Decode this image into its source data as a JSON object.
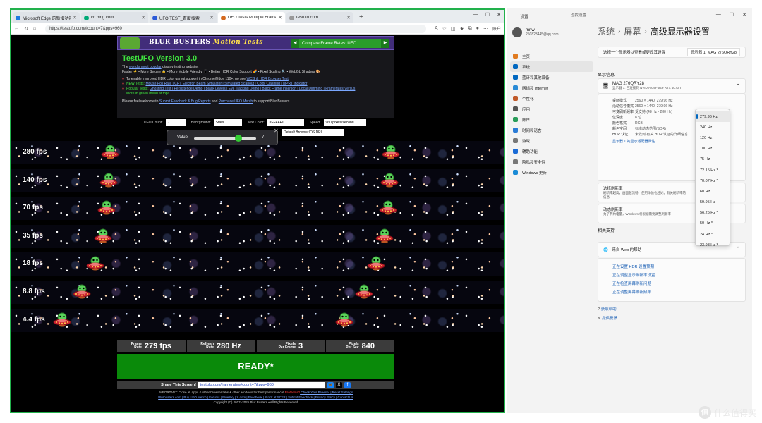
{
  "browser": {
    "tabs": [
      {
        "label": "Microsoft Edge 的新增功能",
        "color": "#1f7ae0"
      },
      {
        "label": "cn.bing.com",
        "color": "#0a7"
      },
      {
        "label": "UFO TEST_百度搜索",
        "color": "#2c5ad8"
      },
      {
        "label": "UFO Tests Multiple Framerates",
        "color": "#d46a1f",
        "active": true
      },
      {
        "label": "testufo.com",
        "color": "#999"
      }
    ],
    "new_tab": "+",
    "url": "https://testufo.com/#count=7&pps=960",
    "account": "账户"
  },
  "header": {
    "brand_a": "BLUR BUSTERS",
    "brand_b": "Motion Tests",
    "compare_select": "Compare Frame Rates: UFO"
  },
  "info": {
    "title": "TestUFO Version 3.0",
    "line1_a": "The ",
    "line1_link": "world's most popular",
    "line1_b": " display testing website.",
    "line2": "Faster ⚡ • More Secure 🔒 • More Mobile Friendly 📱 • Better HDR Color Support 🌈 • Pixel Scaling 🔍 • WebGL Shaders 🎨",
    "b1_a": "To enable improved HDR color gamut support in Chrome/Edge 110+, go see ",
    "b1_link": "WCG & HDR Browser Test",
    "b2_label": "NEW Tests:",
    "b2_links": "Mouse Poll Rate | CRT Electron Beam Simulator | Simulated Scanout | Color Clashing | MPRT Indicator",
    "b3_label": "Popular Tests:",
    "b3_links": "Ghosting Test | Persistence Demo | Black Levels | Eye Tracking Demo | Black Frame Insertion | Local Dimming | Framerates Versus",
    "b3_more": "More in green menu at top!",
    "support_a": "Please feel welcome to ",
    "support_l1": "Submit Feedback & Bug Reports",
    "support_b": " and ",
    "support_l2": "Purchase UFO Merch",
    "support_c": " to support Blur Busters."
  },
  "controls": {
    "ufo_count_label": "UFO Count:",
    "ufo_count": "7",
    "background_label": "Background:",
    "background": "Stars",
    "text_color_label": "Text Color:",
    "text_color": "#FFFFF0",
    "speed_label": "Speed:",
    "speed": "960 pixels/second",
    "value_label": "Value",
    "value": "7",
    "dpi_select": "Default Browser/OS DPI",
    "slider_fraction": 0.72
  },
  "rows": [
    {
      "fps": "280 fps",
      "u1": 0.2,
      "u2": 0.766
    },
    {
      "fps": "140 fps",
      "u1": 0.197,
      "u2": 0.764
    },
    {
      "fps": "70 fps",
      "u1": 0.193,
      "u2": 0.76
    },
    {
      "fps": "35 fps",
      "u1": 0.185,
      "u2": 0.753
    },
    {
      "fps": "18 fps",
      "u1": 0.17,
      "u2": 0.737
    },
    {
      "fps": "8.8 fps",
      "u1": 0.143,
      "u2": 0.712
    },
    {
      "fps": "4.4 fps",
      "u1": 0.103,
      "u2": 0.673
    }
  ],
  "stats": [
    {
      "k1": "Frame",
      "k2": "Rate",
      "v": "279 fps"
    },
    {
      "k1": "Refresh",
      "k2": "Rate",
      "v": "280 Hz"
    },
    {
      "k1": "Pixels",
      "k2": "Per Frame",
      "v": "3"
    },
    {
      "k1": "Pixels",
      "k2": "Per Sec",
      "v": "840"
    }
  ],
  "ready": "READY*",
  "share": {
    "label": "Share This Screen!",
    "url": "testufo.com/framerates#count=7&pps=960"
  },
  "footer": {
    "l1_a": "IMPORTANT: Close all apps & other browser tabs & other windows for best performance! ",
    "l1_red": "Problems?",
    "l1_links": " Check Your Browser | Reset Settings",
    "l2": "Blurbusters.com | Buy UFO Merch | Forums | BlueSky | X.com | Facebook | Stock at SCE2 | Submit Feedback | Privacy Policy | Contact Us",
    "l3": "Copyright (C) 2017–2025 Blur Busters • All Rights Reserved"
  },
  "settings": {
    "title": "设置",
    "search": "查找设置",
    "user_name": "mr.w",
    "user_email": "250823445@qq.com",
    "nav": [
      {
        "label": "主页",
        "color": "#e07a1f"
      },
      {
        "label": "系统",
        "color": "#0067c0",
        "active": true
      },
      {
        "label": "蓝牙和其他设备",
        "color": "#0067c0"
      },
      {
        "label": "网络和 Internet",
        "color": "#2a8bd6"
      },
      {
        "label": "个性化",
        "color": "#c05a2a"
      },
      {
        "label": "应用",
        "color": "#555"
      },
      {
        "label": "账户",
        "color": "#2a9d5a"
      },
      {
        "label": "时间和语言",
        "color": "#2a7bd6"
      },
      {
        "label": "游戏",
        "color": "#777"
      },
      {
        "label": "辅助功能",
        "color": "#1a6bd6"
      },
      {
        "label": "隐私和安全性",
        "color": "#777"
      },
      {
        "label": "Windows 更新",
        "color": "#1a8bd6"
      }
    ],
    "crumb": [
      "系统",
      "屏幕",
      "高级显示器设置"
    ],
    "display_select_label": "选择一个显示器以查看或更改其设置",
    "display_select": "显示器 1: MAG 276QRY28",
    "display_info": "显示信息",
    "monitor_name": "MAG 276QRY28",
    "monitor_sub": "显示器 1: 已连接到 NVIDIA GeForce RTX 4070 Ti",
    "rows": [
      {
        "k": "桌面模式",
        "v": "2560 × 1440, 279.96 Hz"
      },
      {
        "k": "活动信号模式",
        "v": "2560 × 1440, 279.96 Hz"
      },
      {
        "k": "可变刷新频率",
        "v": "受支持 (48 Hz - 280 Hz)"
      },
      {
        "k": "位深度",
        "v": "8 位"
      },
      {
        "k": "颜色格式",
        "v": "RGB"
      },
      {
        "k": "颜色空间",
        "v": "标准动态范围(SDR)"
      },
      {
        "k": "HDR 认证",
        "v": "未找到 有关 HDR 认证的详细信息"
      }
    ],
    "adapter_link": "显示器 1 的显示适配器属性",
    "refresh_title": "选择刷新率",
    "refresh_desc": "刷新率越高，画面越流畅，使用体验也越好。有关刷新率的信息",
    "dyn_title": "动态刷新率",
    "dyn_desc": "为了节约电量，Windows 将根据需要调整刷新率",
    "related": "相关支持",
    "help_title": "来自 Web 的帮助",
    "help_links": [
      "正在设置 HDR 设置预期",
      "正在调整显示刷新率设置",
      "正在检查屏幕刷新问题",
      "正在调整屏幕刷新频率"
    ],
    "get_help": "获取帮助",
    "feedback": "提供反馈",
    "refresh_options": [
      "279.96 Hz",
      "240 Hz",
      "120 Hz",
      "100 Hz",
      "75 Hz",
      "72.15 Hz *",
      "70.07 Hz *",
      "60 Hz",
      "59.95 Hz",
      "56.25 Hz *",
      "50 Hz *",
      "24 Hz *",
      "23.98 Hz *"
    ],
    "selected_option": "279.96 Hz"
  },
  "watermark": "什么值得买"
}
